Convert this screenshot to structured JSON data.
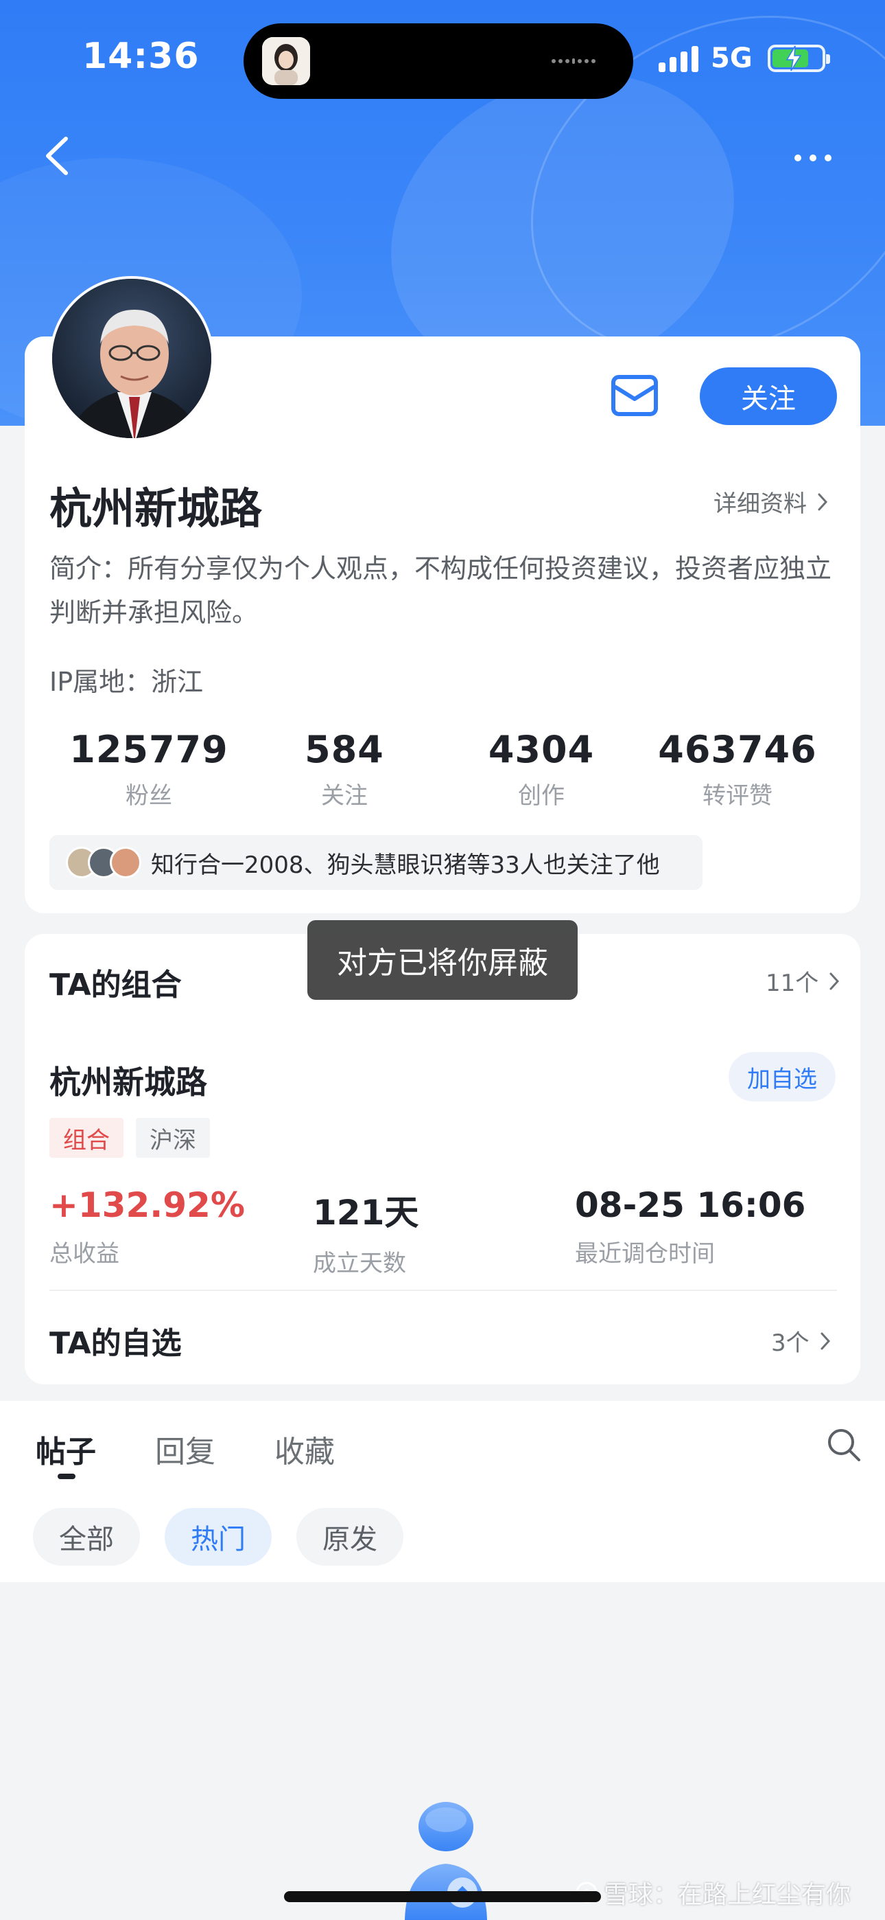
{
  "status_bar": {
    "time": "14:36",
    "network": "5G"
  },
  "colors": {
    "accent": "#2f7cf6",
    "up": "#e04a4a",
    "battery": "#41d157"
  },
  "nav": {
    "back_icon": "chevron-left-icon",
    "more_icon": "more-horizontal-icon"
  },
  "profile": {
    "name": "杭州新城路",
    "follow_label": "关注",
    "message_icon": "mail-icon",
    "detail_label": "详细资料",
    "bio": "简介：所有分享仅为个人观点，不构成任何投资建议，投资者应独立判断并承担风险。",
    "ip": "IP属地：浙江",
    "stats": [
      {
        "value": "125779",
        "label": "粉丝"
      },
      {
        "value": "584",
        "label": "关注"
      },
      {
        "value": "4304",
        "label": "创作"
      },
      {
        "value": "463746",
        "label": "转评赞"
      }
    ],
    "mutual_text": "知行合一2008、狗头慧眼识猪等33人也关注了他"
  },
  "toast": "对方已将你屏蔽",
  "portfolio_section": {
    "title": "TA的组合",
    "count": "11个",
    "portfolio": {
      "name": "杭州新城路",
      "add_label": "加自选",
      "tags": [
        "组合",
        "沪深"
      ],
      "metrics": [
        {
          "value": "+132.92%",
          "label": "总收益"
        },
        {
          "value": "121天",
          "label": "成立天数"
        },
        {
          "value": "08-25 16:06",
          "label": "最近调仓时间"
        }
      ]
    }
  },
  "watchlist_section": {
    "title": "TA的自选",
    "count": "3个"
  },
  "tabs": [
    {
      "label": "帖子",
      "active": true
    },
    {
      "label": "回复",
      "active": false
    },
    {
      "label": "收藏",
      "active": false
    }
  ],
  "filters": [
    {
      "label": "全部",
      "active": false
    },
    {
      "label": "热门",
      "active": true
    },
    {
      "label": "原发",
      "active": false
    }
  ],
  "watermark": "雪球：在路上红尘有你"
}
